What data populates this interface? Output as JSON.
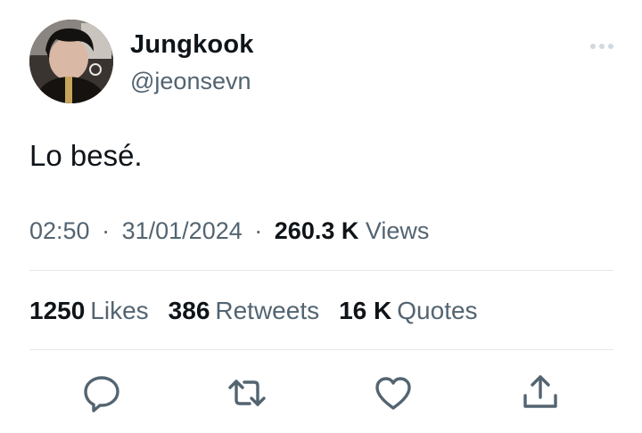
{
  "author": {
    "display_name": "Jungkook",
    "handle": "@jeonsevn"
  },
  "tweet": {
    "text": "Lo besé.",
    "time": "02:50",
    "date": "31/01/2024",
    "separator": "·",
    "views_count": "260.3 K",
    "views_label": "Views"
  },
  "stats": {
    "likes_count": "1250",
    "likes_label": "Likes",
    "retweets_count": "386",
    "retweets_label": "Retweets",
    "quotes_count": "16 K",
    "quotes_label": "Quotes"
  },
  "icons": {
    "more": "more-options-icon",
    "reply": "reply-icon",
    "retweet": "retweet-icon",
    "like": "heart-icon",
    "share": "share-icon"
  },
  "colors": {
    "text_primary": "#0f1419",
    "text_secondary": "#536471",
    "icon": "#536471",
    "divider": "#e6e9ec"
  }
}
